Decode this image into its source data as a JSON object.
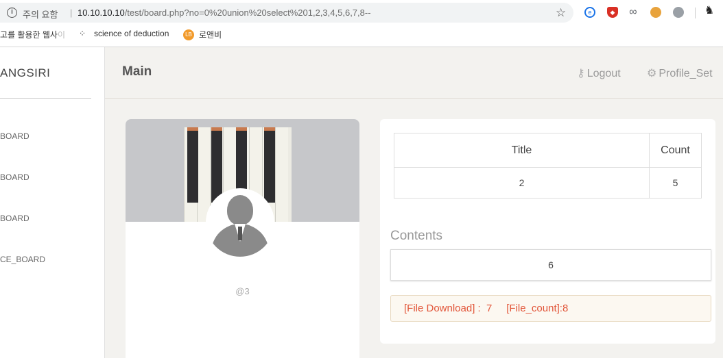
{
  "browser": {
    "security_label": "주의 요함",
    "url_host": "10.10.10.10",
    "url_rest": "/test/board.php?no=0%20union%20select%201,2,3,4,5,6,7,8--",
    "bookmarks": [
      {
        "label": "고를 활용한 웹사",
        "fade": "이"
      },
      {
        "label": "science of deduction"
      },
      {
        "label": "로앤비",
        "icon_text": "LB"
      }
    ]
  },
  "sidebar": {
    "brand": "ANGSIRI",
    "items": [
      {
        "label": "BOARD"
      },
      {
        "label": "BOARD"
      },
      {
        "label": "BOARD"
      },
      {
        "label": "CE_BOARD"
      }
    ]
  },
  "header": {
    "title": "Main",
    "logout": "Logout",
    "profile_set": "Profile_Set"
  },
  "profile": {
    "handle": "@3"
  },
  "post": {
    "table": {
      "headers": [
        "Title",
        "Count"
      ],
      "row": [
        "2",
        "5"
      ]
    },
    "contents_label": "Contents",
    "contents_value": "6",
    "file_line": "[File Download] :  7     [File_count]:8"
  }
}
